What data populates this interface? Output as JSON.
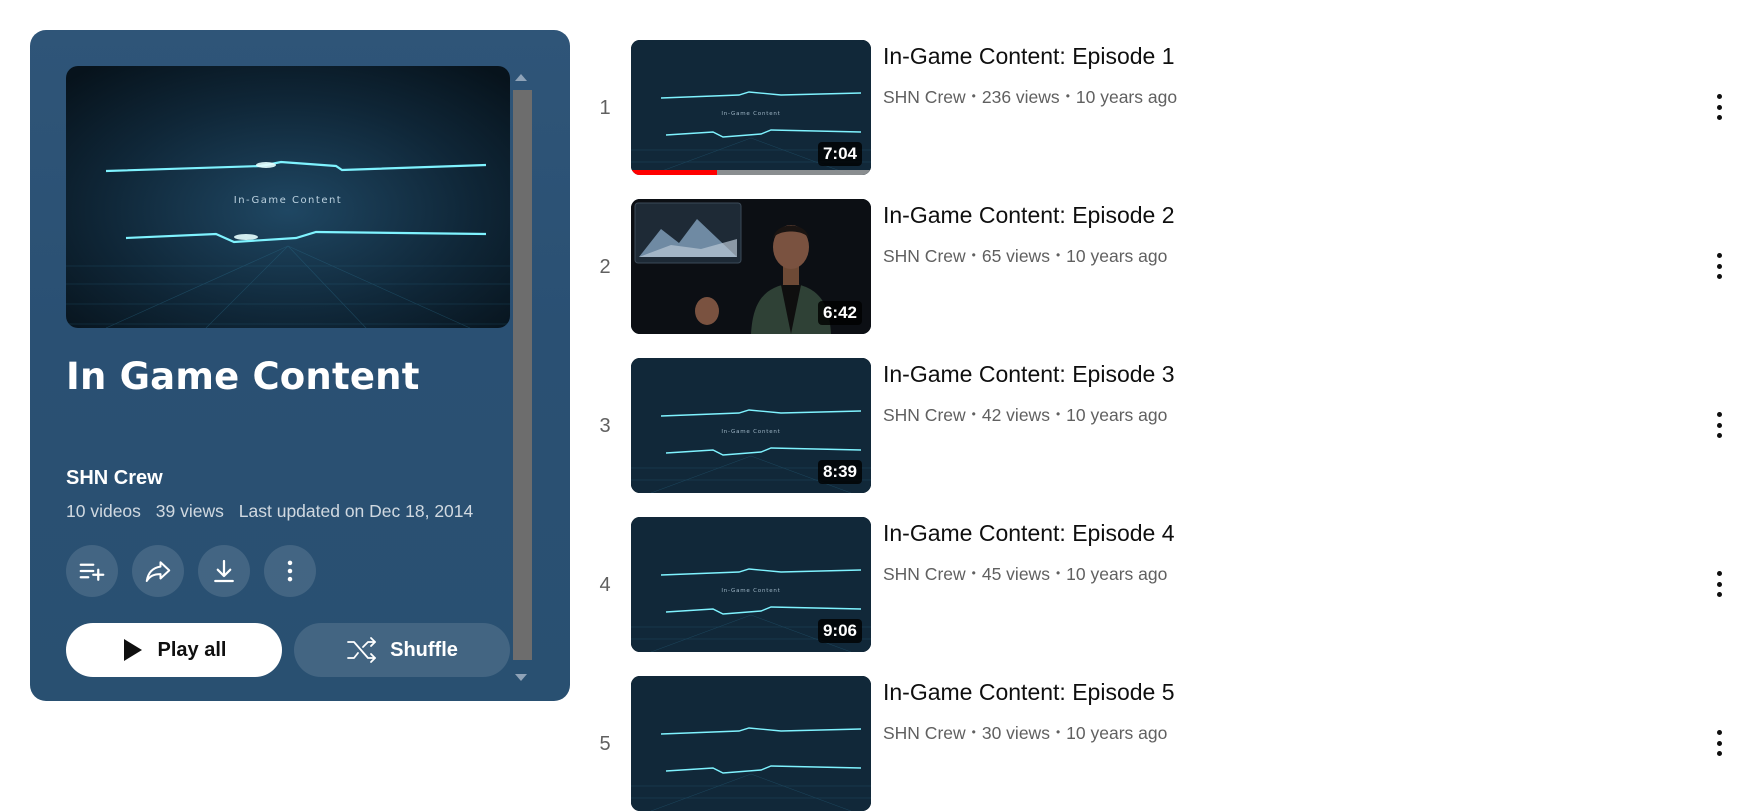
{
  "playlist": {
    "title": "In Game Content",
    "owner": "SHN Crew",
    "video_count": "10 videos",
    "views": "39 views",
    "updated": "Last updated on Dec 18, 2014",
    "thumbnail_caption": "In-Game Content",
    "play_all_label": "Play all",
    "shuffle_label": "Shuffle",
    "icons": [
      "add-to-queue-icon",
      "share-icon",
      "download-icon",
      "more-vert-icon"
    ]
  },
  "videos": [
    {
      "index": "1",
      "title": "In-Game Content: Episode 1",
      "channel": "SHN Crew",
      "views": "236 views",
      "age": "10 years ago",
      "duration": "7:04",
      "thumb_caption": "In-Game Content",
      "watched_fraction": 0.36,
      "thumb_kind": "logo"
    },
    {
      "index": "2",
      "title": "In-Game Content: Episode 2",
      "channel": "SHN Crew",
      "views": "65 views",
      "age": "10 years ago",
      "duration": "6:42",
      "thumb_kind": "presenter"
    },
    {
      "index": "3",
      "title": "In-Game Content: Episode 3",
      "channel": "SHN Crew",
      "views": "42 views",
      "age": "10 years ago",
      "duration": "8:39",
      "thumb_caption": "In-Game Content",
      "thumb_kind": "logo"
    },
    {
      "index": "4",
      "title": "In-Game Content: Episode 4",
      "channel": "SHN Crew",
      "views": "45 views",
      "age": "10 years ago",
      "duration": "9:06",
      "thumb_caption": "In-Game Content",
      "thumb_kind": "logo"
    },
    {
      "index": "5",
      "title": "In-Game Content: Episode 5",
      "channel": "SHN Crew",
      "views": "30 views",
      "age": "10 years ago",
      "duration": "",
      "thumb_kind": "logo"
    }
  ],
  "colors": {
    "panel": "#2a5073",
    "progress": "#ff0000",
    "text_secondary": "#606060"
  }
}
